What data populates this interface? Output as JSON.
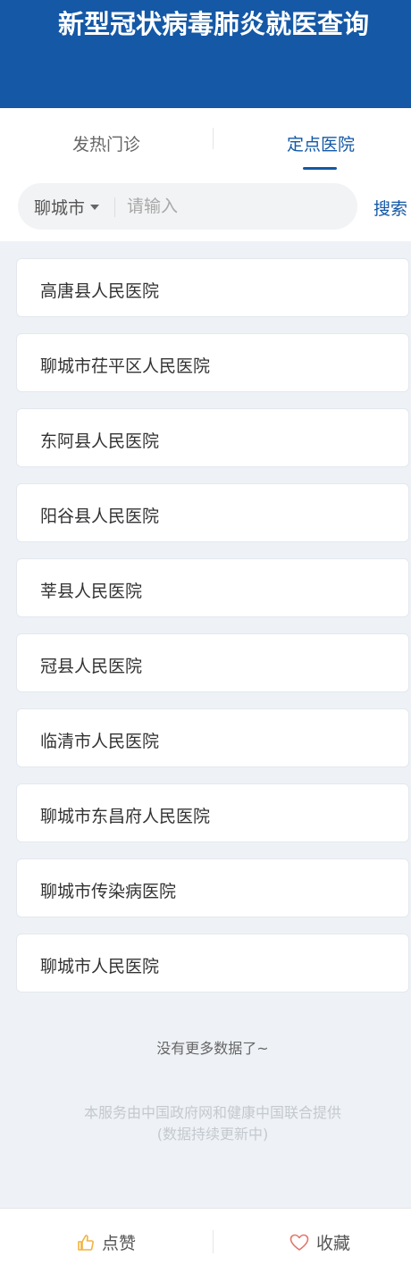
{
  "header": {
    "title": "新型冠状病毒肺炎就医查询"
  },
  "tabs": [
    {
      "label": "发热门诊",
      "active": false
    },
    {
      "label": "定点医院",
      "active": true
    }
  ],
  "search": {
    "city": "聊城市",
    "placeholder": "请输入",
    "value": "",
    "button_label": "搜索"
  },
  "hospitals": [
    "高唐县人民医院",
    "聊城市茌平区人民医院",
    "东阿县人民医院",
    "阳谷县人民医院",
    "莘县人民医院",
    "冠县人民医院",
    "临清市人民医院",
    "聊城市东昌府人民医院",
    "聊城市传染病医院",
    "聊城市人民医院"
  ],
  "no_more_text": "没有更多数据了~",
  "footer": {
    "line1": "本服务由中国政府网和健康中国联合提供",
    "line2": "(数据持续更新中)"
  },
  "bottom_bar": {
    "like_label": "点赞",
    "like_icon": "thumbs-up-icon",
    "favorite_label": "收藏",
    "favorite_icon": "heart-icon"
  },
  "colors": {
    "brand_blue": "#1458a6",
    "background": "#eef2f6",
    "like_icon": "#f2b33d",
    "favorite_icon": "#e0776f"
  }
}
